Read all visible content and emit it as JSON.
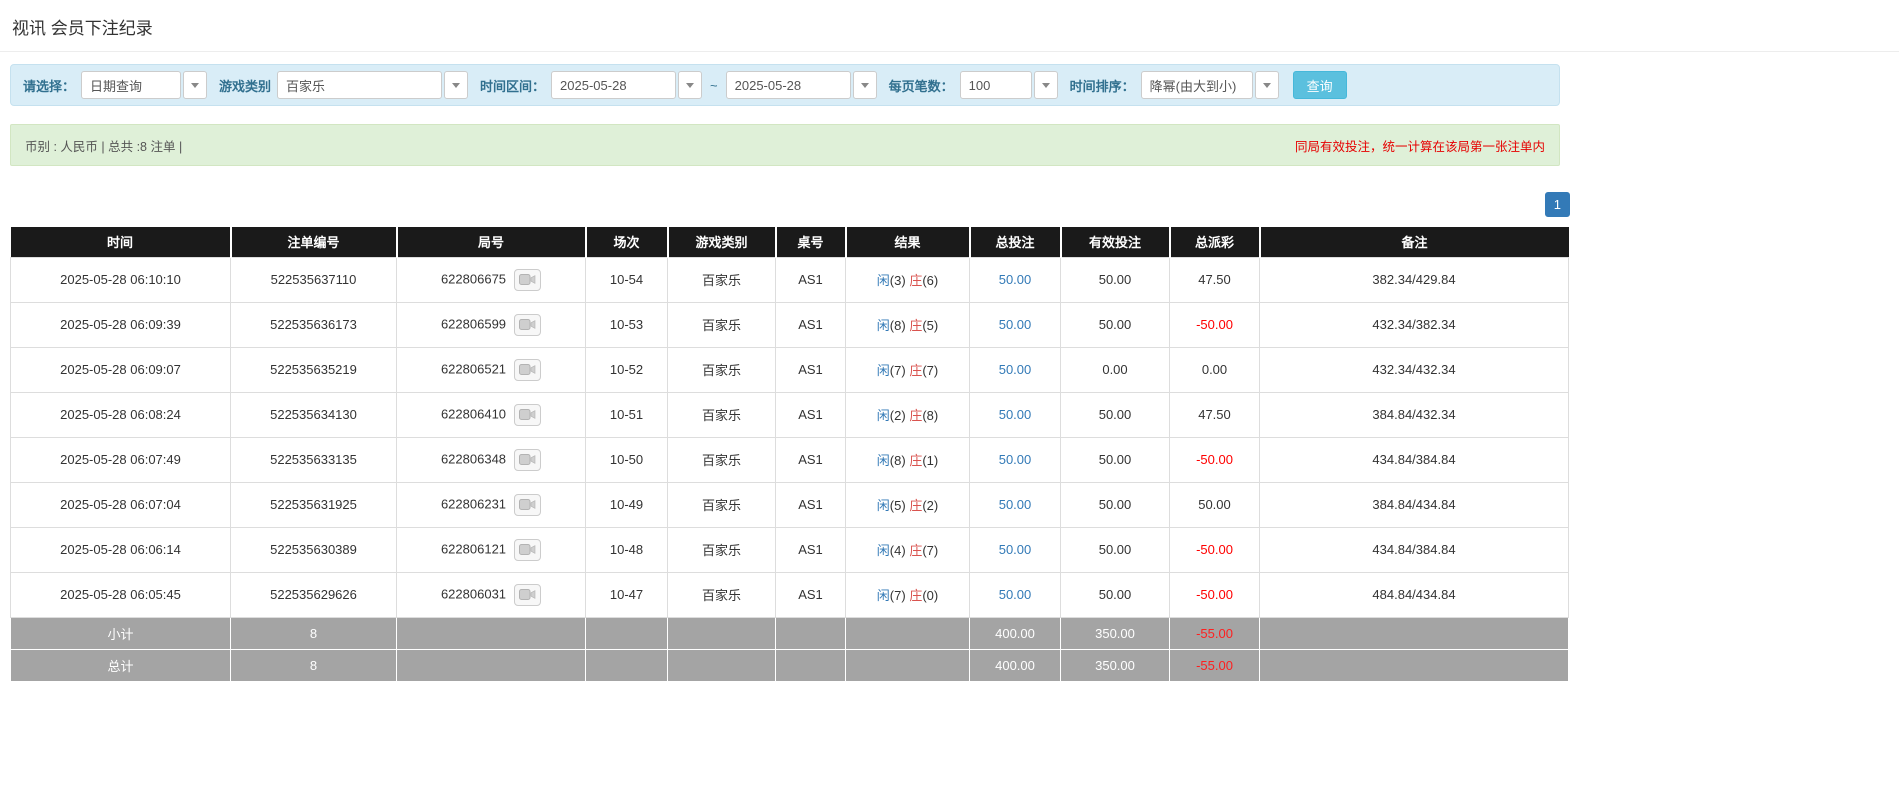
{
  "page": {
    "title": "视讯 会员下注纪录"
  },
  "filters": {
    "select_label": "请选择：",
    "select_value": "日期查询",
    "game_type_label": "游戏类别",
    "game_type_value": "百家乐",
    "time_range_label": "时间区间：",
    "date_from": "2025-05-28",
    "tilde": "~",
    "date_to": "2025-05-28",
    "page_size_label": "每页笔数：",
    "page_size_value": "100",
    "sort_label": "时间排序：",
    "sort_value": "降幂(由大到小)",
    "search_button": "查询"
  },
  "summary": {
    "left": "币别 : 人民币 | 总共 :8 注单 |",
    "right": "同局有效投注，统一计算在该局第一张注单内"
  },
  "pagination": {
    "page": "1"
  },
  "table": {
    "headers": [
      "时间",
      "注单编号",
      "局号",
      "场次",
      "游戏类别",
      "桌号",
      "结果",
      "总投注",
      "有效投注",
      "总派彩",
      "备注"
    ],
    "rows": [
      {
        "time": "2025-05-28 06:10:10",
        "bet_id": "522535637110",
        "round_id": "622806675",
        "session": "10-54",
        "game_type": "百家乐",
        "table_no": "AS1",
        "result_player": "闲(3)",
        "result_banker": "庄(6)",
        "total_bet": "50.00",
        "valid_bet": "50.00",
        "payout": "47.50",
        "remark": "382.34/429.84"
      },
      {
        "time": "2025-05-28 06:09:39",
        "bet_id": "522535636173",
        "round_id": "622806599",
        "session": "10-53",
        "game_type": "百家乐",
        "table_no": "AS1",
        "result_player": "闲(8)",
        "result_banker": "庄(5)",
        "total_bet": "50.00",
        "valid_bet": "50.00",
        "payout": "-50.00",
        "remark": "432.34/382.34"
      },
      {
        "time": "2025-05-28 06:09:07",
        "bet_id": "522535635219",
        "round_id": "622806521",
        "session": "10-52",
        "game_type": "百家乐",
        "table_no": "AS1",
        "result_player": "闲(7)",
        "result_banker": "庄(7)",
        "total_bet": "50.00",
        "valid_bet": "0.00",
        "payout": "0.00",
        "remark": "432.34/432.34"
      },
      {
        "time": "2025-05-28 06:08:24",
        "bet_id": "522535634130",
        "round_id": "622806410",
        "session": "10-51",
        "game_type": "百家乐",
        "table_no": "AS1",
        "result_player": "闲(2)",
        "result_banker": "庄(8)",
        "total_bet": "50.00",
        "valid_bet": "50.00",
        "payout": "47.50",
        "remark": "384.84/432.34"
      },
      {
        "time": "2025-05-28 06:07:49",
        "bet_id": "522535633135",
        "round_id": "622806348",
        "session": "10-50",
        "game_type": "百家乐",
        "table_no": "AS1",
        "result_player": "闲(8)",
        "result_banker": "庄(1)",
        "total_bet": "50.00",
        "valid_bet": "50.00",
        "payout": "-50.00",
        "remark": "434.84/384.84"
      },
      {
        "time": "2025-05-28 06:07:04",
        "bet_id": "522535631925",
        "round_id": "622806231",
        "session": "10-49",
        "game_type": "百家乐",
        "table_no": "AS1",
        "result_player": "闲(5)",
        "result_banker": "庄(2)",
        "total_bet": "50.00",
        "valid_bet": "50.00",
        "payout": "50.00",
        "remark": "384.84/434.84"
      },
      {
        "time": "2025-05-28 06:06:14",
        "bet_id": "522535630389",
        "round_id": "622806121",
        "session": "10-48",
        "game_type": "百家乐",
        "table_no": "AS1",
        "result_player": "闲(4)",
        "result_banker": "庄(7)",
        "total_bet": "50.00",
        "valid_bet": "50.00",
        "payout": "-50.00",
        "remark": "434.84/384.84"
      },
      {
        "time": "2025-05-28 06:05:45",
        "bet_id": "522535629626",
        "round_id": "622806031",
        "session": "10-47",
        "game_type": "百家乐",
        "table_no": "AS1",
        "result_player": "闲(7)",
        "result_banker": "庄(0)",
        "total_bet": "50.00",
        "valid_bet": "50.00",
        "payout": "-50.00",
        "remark": "484.84/434.84"
      }
    ],
    "subtotal": {
      "label": "小计",
      "count": "8",
      "total_bet": "400.00",
      "valid_bet": "350.00",
      "payout": "-55.00"
    },
    "total": {
      "label": "总计",
      "count": "8",
      "total_bet": "400.00",
      "valid_bet": "350.00",
      "payout": "-55.00"
    }
  },
  "colors": {
    "accent_blue": "#337ab7",
    "banker_red": "#d9534f",
    "negative_red": "#ff0000",
    "search_button": "#5bc0de",
    "filter_bar_bg": "#d9edf7",
    "summary_bar_bg": "#dff0d8",
    "table_header_bg": "#1a1a1a",
    "footer_row_bg": "#a4a4a4"
  }
}
